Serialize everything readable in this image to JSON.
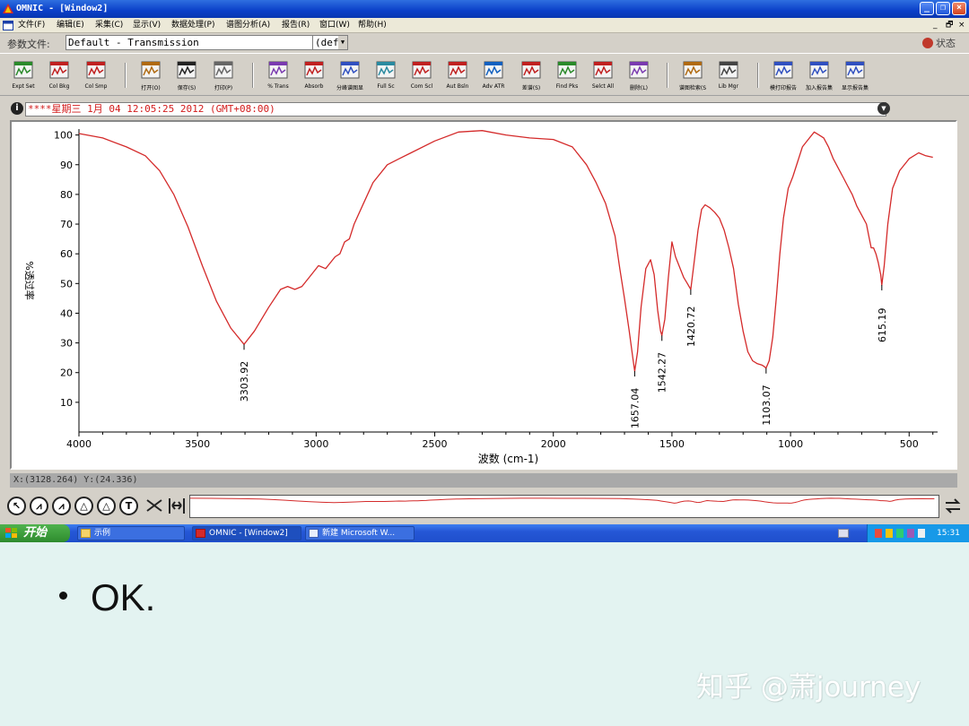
{
  "window": {
    "title": "OMNIC - [Window2]",
    "controls": [
      "_",
      "❐",
      "×"
    ]
  },
  "menu": {
    "items": [
      "文件(F)",
      "编辑(E)",
      "采集(C)",
      "显示(V)",
      "数据处理(P)",
      "谱图分析(A)",
      "报告(R)",
      "窗口(W)",
      "帮助(H)"
    ],
    "mdi_controls": [
      "_",
      "🗗",
      "×"
    ]
  },
  "params": {
    "label": "参数文件:",
    "value": "Default - Transmission",
    "dropdown": "(def",
    "status": "状态"
  },
  "toolbar": {
    "buttons": [
      {
        "label": "Expt Set",
        "icon": "experiment-setup-icon",
        "color": "#2a8a2a"
      },
      {
        "label": "Col Bkg",
        "icon": "collect-background-icon",
        "color": "#c02020"
      },
      {
        "label": "Col Smp",
        "icon": "collect-sample-icon",
        "color": "#c02020"
      },
      {
        "label": "打开(O)",
        "icon": "open-icon",
        "color": "#b06a10"
      },
      {
        "label": "保存(S)",
        "icon": "save-icon",
        "color": "#222222"
      },
      {
        "label": "打印(P)",
        "icon": "print-icon",
        "color": "#666666"
      },
      {
        "label": "% Trans",
        "icon": "percent-transmittance-icon",
        "color": "#7a3ab0"
      },
      {
        "label": "Absorb",
        "icon": "absorbance-icon",
        "color": "#c02020"
      },
      {
        "label": "分峰谱图显",
        "icon": "split-spectra-icon",
        "color": "#3050c0"
      },
      {
        "label": "Full Sc",
        "icon": "full-scale-icon",
        "color": "#2a8aa0"
      },
      {
        "label": "Com Scl",
        "icon": "common-scale-icon",
        "color": "#c02020"
      },
      {
        "label": "Aut Bsln",
        "icon": "auto-baseline-icon",
        "color": "#c02020"
      },
      {
        "label": "Adv ATR",
        "icon": "advanced-atr-icon",
        "color": "#1060c0"
      },
      {
        "label": "差谱(S)",
        "icon": "subtract-icon",
        "color": "#c02020"
      },
      {
        "label": "Find Pks",
        "icon": "find-peaks-icon",
        "color": "#2a8a2a"
      },
      {
        "label": "Selct All",
        "icon": "select-all-icon",
        "color": "#c02020"
      },
      {
        "label": "删除(L)",
        "icon": "delete-icon",
        "color": "#7a3ab0"
      },
      {
        "label": "谱图检索(S",
        "icon": "search-spectra-icon",
        "color": "#b06a10"
      },
      {
        "label": "Lib Mgr",
        "icon": "library-manager-icon",
        "color": "#444444"
      },
      {
        "label": "模打印报告",
        "icon": "template-print-icon",
        "color": "#3050c0"
      },
      {
        "label": "加入报告集",
        "icon": "add-to-report-icon",
        "color": "#3050c0"
      },
      {
        "label": "显示报告集",
        "icon": "show-report-icon",
        "color": "#3050c0"
      }
    ]
  },
  "spectrum": {
    "info_icon": "i",
    "title": "****星期三 1月 04 12:05:25 2012 (GMT+08:00)"
  },
  "chart_data": {
    "type": "line",
    "title": "",
    "xlabel": "波数 (cm-1)",
    "ylabel": "%透过率",
    "xlim": [
      4000,
      380
    ],
    "ylim": [
      0,
      102
    ],
    "x_ticks": [
      4000,
      3500,
      3000,
      2500,
      2000,
      1500,
      1000,
      500
    ],
    "y_ticks": [
      10,
      20,
      30,
      40,
      50,
      60,
      70,
      80,
      90,
      100
    ],
    "grid": false,
    "color": "#d42a2a",
    "series": [
      {
        "x": [
          4000,
          3900,
          3800,
          3720,
          3660,
          3600,
          3540,
          3480,
          3420,
          3360,
          3303.92,
          3260,
          3200,
          3150,
          3120,
          3090,
          3060,
          3020,
          2990,
          2960,
          2940,
          2920,
          2900,
          2880,
          2860,
          2840,
          2800,
          2760,
          2700,
          2650,
          2600,
          2500,
          2400,
          2300,
          2200,
          2100,
          2000,
          1920,
          1860,
          1820,
          1780,
          1740,
          1720,
          1700,
          1680,
          1665,
          1657.04,
          1645,
          1630,
          1610,
          1590,
          1575,
          1560,
          1548,
          1542.27,
          1530,
          1515,
          1500,
          1485,
          1470,
          1450,
          1435,
          1420.72,
          1405,
          1390,
          1375,
          1360,
          1340,
          1320,
          1300,
          1280,
          1260,
          1240,
          1220,
          1200,
          1180,
          1160,
          1140,
          1120,
          1110,
          1103.07,
          1090,
          1075,
          1060,
          1045,
          1030,
          1010,
          990,
          970,
          950,
          920,
          900,
          880,
          860,
          840,
          820,
          800,
          780,
          760,
          740,
          720,
          700,
          680,
          670,
          660,
          650,
          640,
          630,
          620,
          615.19,
          605,
          590,
          570,
          540,
          500,
          460,
          430,
          400
        ],
        "y": [
          100.5,
          99,
          96,
          93,
          88,
          80,
          69,
          56,
          44,
          35,
          29.5,
          34,
          42,
          48,
          49,
          48,
          49,
          53,
          56,
          55,
          57,
          59,
          60,
          64,
          65,
          70,
          77,
          84,
          90,
          92,
          94,
          98,
          101,
          101.5,
          100,
          99,
          98.5,
          96,
          90,
          84,
          77,
          66,
          55,
          45,
          34,
          25,
          20.5,
          27,
          42,
          55,
          58,
          53,
          41,
          34,
          32.5,
          38,
          52,
          64,
          59,
          56,
          52,
          50,
          48,
          58,
          68,
          75,
          76.5,
          75.5,
          74,
          72,
          68,
          62,
          55,
          43,
          34,
          27,
          24,
          23,
          22.5,
          22,
          21.5,
          24,
          32,
          45,
          60,
          72,
          82,
          86,
          91,
          96,
          99,
          101,
          100,
          99,
          96,
          92,
          89,
          86,
          83,
          80,
          76,
          73,
          70,
          66,
          62,
          62,
          60,
          57,
          53,
          49.5,
          56,
          70,
          82,
          88,
          92,
          94,
          93,
          92.5
        ]
      }
    ],
    "annotations": [
      {
        "x": 3303.92,
        "y": 29.5,
        "label": "3303.92"
      },
      {
        "x": 1657.04,
        "y": 20.5,
        "label": "1657.04"
      },
      {
        "x": 1542.27,
        "y": 32.5,
        "label": "1542.27"
      },
      {
        "x": 1420.72,
        "y": 48,
        "label": "1420.72"
      },
      {
        "x": 1103.07,
        "y": 21.5,
        "label": "1103.07"
      },
      {
        "x": 615.19,
        "y": 49.5,
        "label": "615.19"
      }
    ]
  },
  "cursor": {
    "readout": "X:(3128.264) Y:(24.336)"
  },
  "nav": {
    "tools": [
      {
        "name": "select-tool",
        "glyph": "↖"
      },
      {
        "name": "region-tool",
        "glyph": "⩘"
      },
      {
        "name": "peak-height-tool",
        "glyph": "⩘"
      },
      {
        "name": "peak-area-tool",
        "glyph": "△"
      },
      {
        "name": "baseline-tool",
        "glyph": "△"
      },
      {
        "name": "text-tool",
        "glyph": "T"
      }
    ]
  },
  "taskbar": {
    "start": "开始",
    "tasks": [
      "示例",
      "OMNIC - [Window2]",
      "新建 Microsoft W..."
    ],
    "clock": "15:31"
  },
  "slide": {
    "bullet": "OK.",
    "watermark": "知乎 @萧journey"
  }
}
